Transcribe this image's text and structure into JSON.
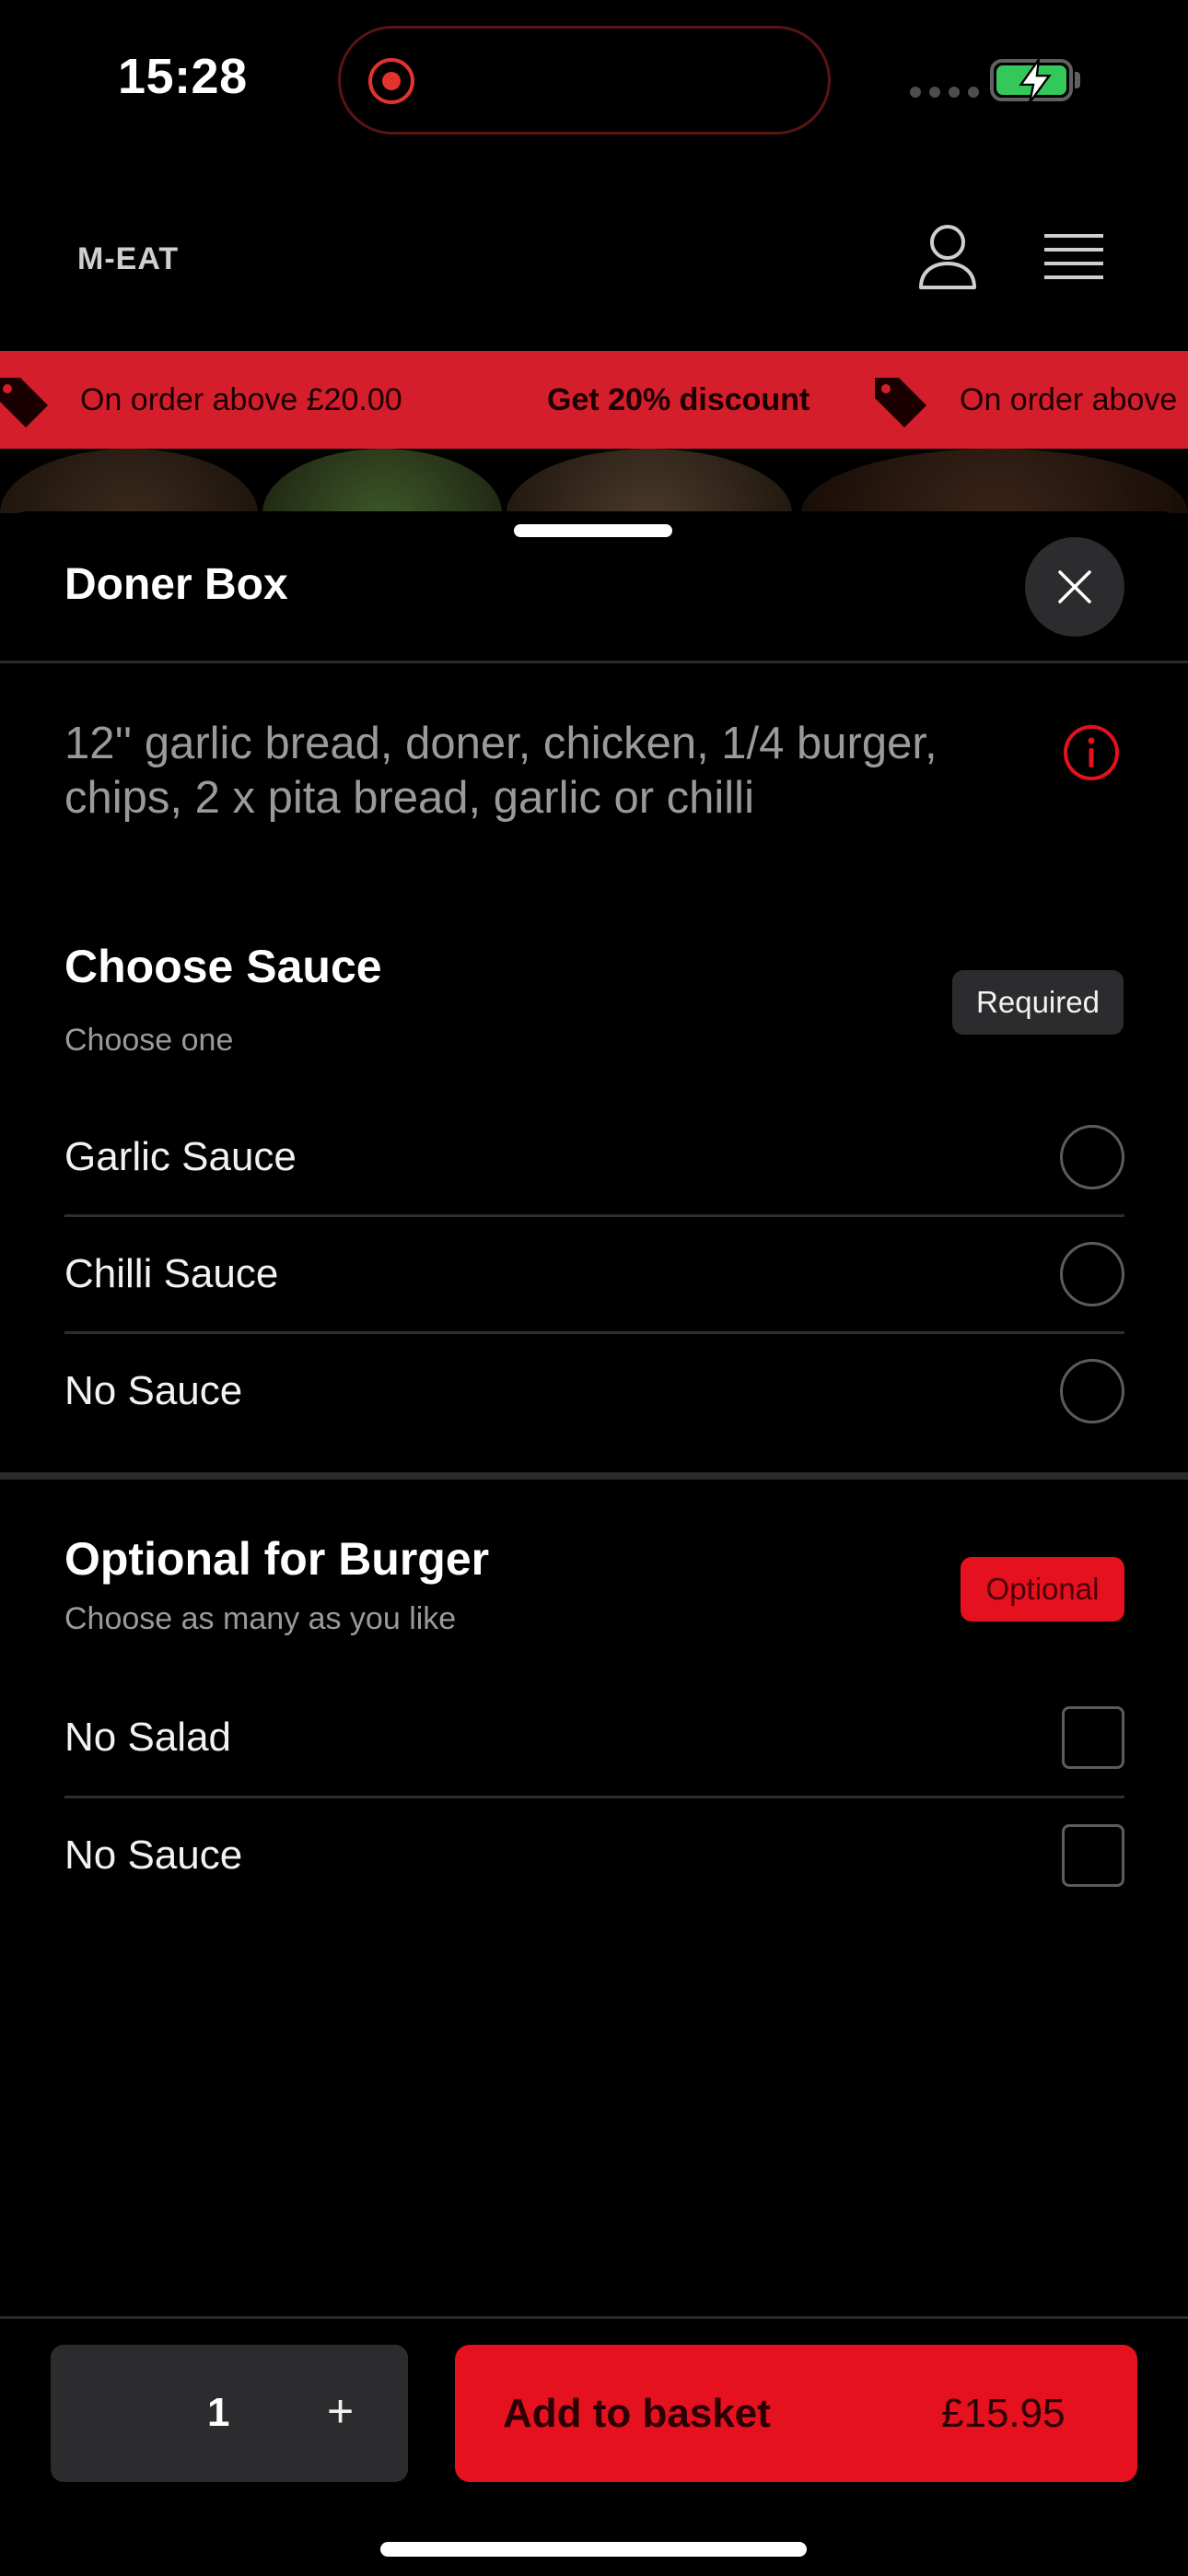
{
  "status_bar": {
    "time": "15:28",
    "icons": [
      "screen-recording-icon",
      "signal-icon",
      "battery-charging-icon"
    ]
  },
  "header": {
    "brand": "M-EAT",
    "icons": [
      "user-icon",
      "menu-icon"
    ]
  },
  "promo": {
    "text_1": "On order above £20.00",
    "text_2": "Get 20% discount",
    "text_3": "On order above",
    "background": "#d41e2c"
  },
  "sheet": {
    "title": "Doner Box",
    "description": "12'' garlic bread, doner, chicken, 1/4 burger, chips, 2 x pita bread, garlic or chilli"
  },
  "choose_sauce": {
    "title": "Choose Sauce",
    "subtitle": "Choose one",
    "badge": "Required",
    "options": [
      {
        "label": "Garlic Sauce",
        "selected": false
      },
      {
        "label": "Chilli Sauce",
        "selected": false
      },
      {
        "label": "No Sauce",
        "selected": false
      }
    ]
  },
  "optional_burger": {
    "title": "Optional for Burger",
    "subtitle": "Choose as many as you like",
    "badge": "Optional",
    "options": [
      {
        "label": "No Salad",
        "checked": false
      },
      {
        "label": "No Sauce",
        "checked": false
      }
    ]
  },
  "bottom_bar": {
    "quantity": "1",
    "plus": "+",
    "add_label": "Add to basket",
    "price": "£15.95",
    "accent": "#e5111f"
  }
}
